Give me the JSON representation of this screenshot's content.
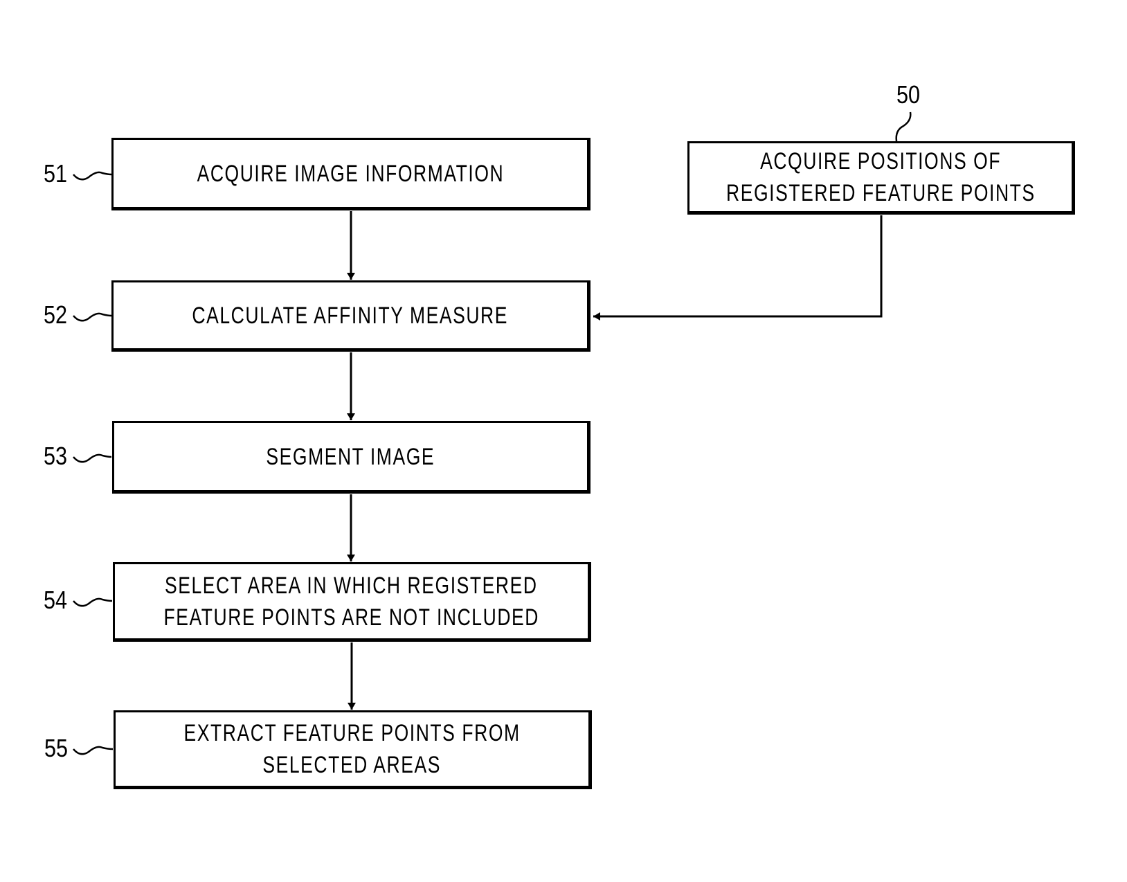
{
  "figure": {
    "steps": [
      {
        "ref": "51",
        "lines": [
          "ACQUIRE IMAGE INFORMATION"
        ]
      },
      {
        "ref": "52",
        "lines": [
          "CALCULATE AFFINITY MEASURE"
        ]
      },
      {
        "ref": "53",
        "lines": [
          "SEGMENT IMAGE"
        ]
      },
      {
        "ref": "54",
        "lines": [
          "SELECT AREA IN WHICH REGISTERED",
          "FEATURE POINTS ARE NOT INCLUDED"
        ]
      },
      {
        "ref": "55",
        "lines": [
          "EXTRACT FEATURE POINTS FROM",
          "SELECTED AREAS"
        ]
      }
    ],
    "side_input": {
      "ref": "50",
      "lines": [
        "ACQUIRE POSITIONS OF",
        "REGISTERED FEATURE POINTS"
      ],
      "feeds_into": "52"
    },
    "flow": [
      "51",
      "52",
      "53",
      "54",
      "55"
    ]
  }
}
